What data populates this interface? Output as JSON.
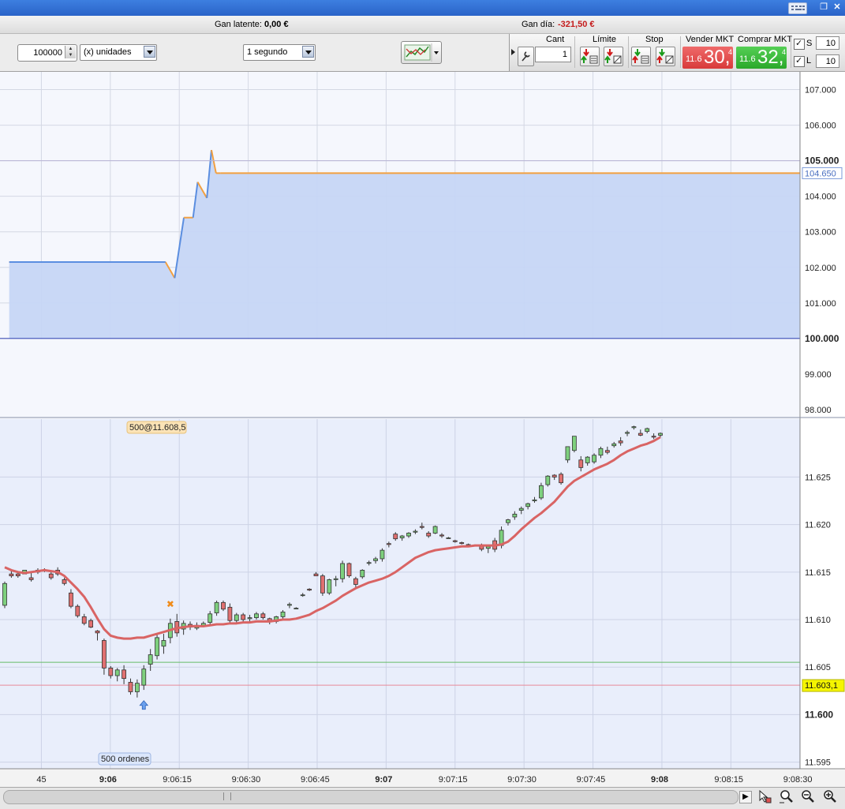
{
  "status": {
    "unrealized_label": "Gan latente:",
    "unrealized_value": "0,00 €",
    "daily_label": "Gan día:",
    "daily_value": "-321,50 €"
  },
  "toolbar": {
    "quantity": "100000",
    "unit_mode": "(x) unidades",
    "interval": "1 segundo"
  },
  "order_panel": {
    "cant_label": "Cant",
    "limit_label": "Límite",
    "stop_label": "Stop",
    "sell_label": "Vender MKT",
    "buy_label": "Comprar MKT",
    "qty_value": "1",
    "sell_prefix": "11.6",
    "sell_big": "30,",
    "sell_tiny": "4",
    "buy_prefix": "11.6",
    "buy_big": "32,",
    "buy_tiny": "4",
    "s_label": "S",
    "s_value": "10",
    "l_label": "L",
    "l_value": "10"
  },
  "colors": {
    "sell": "#e84d4d",
    "buy": "#33b533",
    "equity_line": "#5b8ee0",
    "equity_level_line": "#f2a040",
    "moving_average": "#d96464",
    "bull_candle": "#7ed07e",
    "bear_candle": "#e07070",
    "support_line": "#66bb66",
    "current_price_line": "#e88a9a",
    "current_price_tag": "#f5f500"
  },
  "icons": [
    "settings-wrench-icon",
    "limit-sell-icon",
    "limit-buy-icon",
    "stop-sell-icon",
    "stop-buy-icon",
    "chart-type-icon",
    "scroll-right-icon",
    "cursor-icon",
    "zoom-fit-icon",
    "zoom-out-icon",
    "zoom-in-icon",
    "keyboard-icon",
    "restore-window-icon",
    "close-window-icon"
  ],
  "chart_data": [
    {
      "type": "line",
      "title": "",
      "ylim": [
        97.8,
        107.5
      ],
      "y_ticks": [
        "107.000",
        "106.000",
        "105.000",
        "104.000",
        "103.000",
        "102.000",
        "101.000",
        "100.000",
        "99.000",
        "98.000"
      ],
      "bold_ticks": [
        "105.000",
        "100.000"
      ],
      "reference_level": 100.0,
      "current_value_tag": "104.650",
      "series": [
        {
          "x": [
            "9:05:38",
            "9:06:12",
            "9:06:14",
            "9:06:16",
            "9:06:18",
            "9:06:19",
            "9:06:21",
            "9:06:22",
            "9:06:23",
            "9:06:24",
            "9:08:30"
          ],
          "values": [
            102.15,
            102.15,
            101.7,
            103.4,
            103.4,
            104.4,
            103.95,
            105.3,
            104.65,
            104.65,
            104.65
          ]
        }
      ]
    },
    {
      "type": "candlestick",
      "title": "",
      "ylim": [
        11.5943,
        11.6311
      ],
      "y_ticks": [
        "11.625",
        "11.620",
        "11.615",
        "11.610",
        "11.605",
        "11.600",
        "11.595"
      ],
      "bold_ticks": [
        "11.600"
      ],
      "x_ticks": [
        "9:05:45",
        "9:06",
        "9:06:15",
        "9:06:30",
        "9:06:45",
        "9:07",
        "9:07:15",
        "9:07:30",
        "9:07:45",
        "9:08",
        "9:08:15",
        "9:08:30"
      ],
      "x_tick_labels": [
        "45",
        "9:06",
        "9:06:15",
        "9:06:30",
        "9:06:45",
        "9:07",
        "9:07:15",
        "9:07:30",
        "9:07:45",
        "9:08",
        "9:08:15",
        "9:08:30"
      ],
      "support_level": 11.6055,
      "current_price_level": 11.6031,
      "current_price_tag": "11.603,1",
      "entry_tag": "500@11.608,5",
      "orders_tag": "500 ordenes",
      "ohlc": [
        [
          11.6115,
          11.614,
          11.6112,
          11.6138
        ],
        [
          11.6148,
          11.6152,
          11.6144,
          11.6146
        ],
        [
          11.6148,
          11.615,
          11.6144,
          11.6146
        ],
        [
          11.6148,
          11.6152,
          11.6148,
          11.6152
        ],
        [
          11.6144,
          11.615,
          11.614,
          11.6142
        ],
        [
          11.6152,
          11.6154,
          11.6148,
          11.615
        ],
        [
          11.6152,
          11.6154,
          11.615,
          11.6151
        ],
        [
          11.6148,
          11.6152,
          11.6142,
          11.6144
        ],
        [
          11.6152,
          11.6155,
          11.6146,
          11.6148
        ],
        [
          11.6142,
          11.6144,
          11.6136,
          11.6138
        ],
        [
          11.6128,
          11.6132,
          11.6112,
          11.6114
        ],
        [
          11.6114,
          11.6116,
          11.6102,
          11.6104
        ],
        [
          11.6103,
          11.6106,
          11.6094,
          11.6096
        ],
        [
          11.6099,
          11.6101,
          11.6091,
          11.6092
        ],
        [
          11.6088,
          11.6089,
          11.6078,
          11.6086
        ],
        [
          11.6078,
          11.608,
          11.6042,
          11.6049
        ],
        [
          11.6049,
          11.6051,
          11.6038,
          11.6041
        ],
        [
          11.6041,
          11.6049,
          11.6035,
          11.6047
        ],
        [
          11.6047,
          11.6052,
          11.6032,
          11.6038
        ],
        [
          11.6034,
          11.6038,
          11.6021,
          11.6024
        ],
        [
          11.6024,
          11.6037,
          11.6018,
          11.6033
        ],
        [
          11.6031,
          11.6052,
          11.6026,
          11.6048
        ],
        [
          11.6053,
          11.6069,
          11.6046,
          11.6063
        ],
        [
          11.6062,
          11.6084,
          11.6058,
          11.6081
        ],
        [
          11.6072,
          11.6085,
          11.6064,
          11.6078
        ],
        [
          11.6081,
          11.6101,
          11.6075,
          11.6096
        ],
        [
          11.6098,
          11.6106,
          11.6082,
          11.6086
        ],
        [
          11.609,
          11.6099,
          11.6084,
          11.6096
        ],
        [
          11.6095,
          11.6098,
          11.6089,
          11.6092
        ],
        [
          11.6091,
          11.6097,
          11.6089,
          11.6094
        ],
        [
          11.6093,
          11.6098,
          11.6092,
          11.6096
        ],
        [
          11.6097,
          11.6109,
          11.6095,
          11.6106
        ],
        [
          11.6107,
          11.612,
          11.6104,
          11.6118
        ],
        [
          11.6118,
          11.612,
          11.6109,
          11.6111
        ],
        [
          11.6113,
          11.6117,
          11.6097,
          11.6099
        ],
        [
          11.6099,
          11.6107,
          11.6097,
          11.6105
        ],
        [
          11.6105,
          11.6107,
          11.6097,
          11.61
        ],
        [
          11.6101,
          11.6105,
          11.6097,
          11.6102
        ],
        [
          11.6102,
          11.6108,
          11.61,
          11.6106
        ],
        [
          11.6106,
          11.6108,
          11.61,
          11.6102
        ],
        [
          11.6101,
          11.6102,
          11.6095,
          11.6098
        ],
        [
          11.6098,
          11.6104,
          11.6096,
          11.6103
        ],
        [
          11.6103,
          11.611,
          11.6101,
          11.6108
        ],
        [
          11.6115,
          11.6118,
          11.6112,
          11.6116
        ],
        [
          11.6112,
          11.6113,
          11.6111,
          11.6112
        ],
        [
          11.6126,
          11.6128,
          11.6124,
          11.6126
        ],
        [
          11.6132,
          11.6133,
          11.613,
          11.6131
        ],
        [
          11.6148,
          11.615,
          11.6146,
          11.6146
        ],
        [
          11.6146,
          11.6148,
          11.6125,
          11.6128
        ],
        [
          11.6128,
          11.6143,
          11.6126,
          11.6142
        ],
        [
          11.6142,
          11.6146,
          11.6135,
          11.6143
        ],
        [
          11.6143,
          11.6162,
          11.6139,
          11.6159
        ],
        [
          11.6159,
          11.616,
          11.6144,
          11.6146
        ],
        [
          11.6143,
          11.6145,
          11.6132,
          11.6137
        ],
        [
          11.6145,
          11.6153,
          11.6143,
          11.6152
        ],
        [
          11.616,
          11.6162,
          11.6157,
          11.616
        ],
        [
          11.6162,
          11.6166,
          11.6159,
          11.6164
        ],
        [
          11.6164,
          11.6175,
          11.6161,
          11.6173
        ],
        [
          11.618,
          11.6182,
          11.6176,
          11.6179
        ],
        [
          11.619,
          11.6192,
          11.6183,
          11.6185
        ],
        [
          11.6186,
          11.6189,
          11.6183,
          11.6188
        ],
        [
          11.6188,
          11.6192,
          11.6186,
          11.6191
        ],
        [
          11.6192,
          11.6195,
          11.619,
          11.6193
        ],
        [
          11.6198,
          11.6202,
          11.6195,
          11.6197
        ],
        [
          11.6191,
          11.6193,
          11.6186,
          11.6188
        ],
        [
          11.6191,
          11.6199,
          11.619,
          11.6198
        ],
        [
          11.6189,
          11.6191,
          11.6186,
          11.6188
        ],
        [
          11.6186,
          11.6187,
          11.6185,
          11.6186
        ],
        [
          11.6183,
          11.6184,
          11.6181,
          11.6182
        ],
        [
          11.6181,
          11.6182,
          11.6179,
          11.618
        ],
        [
          11.6179,
          11.618,
          11.6177,
          11.6178
        ],
        [
          11.6178,
          11.6179,
          11.6177,
          11.6178
        ],
        [
          11.6178,
          11.618,
          11.6172,
          11.6174
        ],
        [
          11.6175,
          11.6178,
          11.617,
          11.6177
        ],
        [
          11.6183,
          11.6186,
          11.6171,
          11.6174
        ],
        [
          11.6178,
          11.6198,
          11.6175,
          11.6194
        ],
        [
          11.6202,
          11.6206,
          11.6199,
          11.6205
        ],
        [
          11.6208,
          11.6214,
          11.6205,
          11.6211
        ],
        [
          11.6215,
          11.6219,
          11.6211,
          11.6217
        ],
        [
          11.6219,
          11.6223,
          11.6216,
          11.6222
        ],
        [
          11.6225,
          11.6229,
          11.6223,
          11.6226
        ],
        [
          11.6228,
          11.6244,
          11.6226,
          11.6241
        ],
        [
          11.6242,
          11.6252,
          11.624,
          11.6251
        ],
        [
          11.6252,
          11.6253,
          11.6247,
          11.625
        ],
        [
          11.6253,
          11.6255,
          11.6242,
          11.6244
        ],
        [
          11.6268,
          11.6282,
          11.6265,
          11.6282
        ],
        [
          11.6278,
          11.6293,
          11.6276,
          11.6293
        ],
        [
          11.6268,
          11.6272,
          11.6256,
          11.626
        ],
        [
          11.6265,
          11.6272,
          11.6262,
          11.6271
        ],
        [
          11.6266,
          11.6275,
          11.6264,
          11.6273
        ],
        [
          11.6273,
          11.6282,
          11.627,
          11.628
        ],
        [
          11.6278,
          11.6282,
          11.6274,
          11.6276
        ],
        [
          11.6283,
          11.6287,
          11.6281,
          11.6285
        ],
        [
          11.6288,
          11.6292,
          11.6283,
          11.6286
        ],
        [
          11.6296,
          11.6299,
          11.6293,
          11.6297
        ],
        [
          11.6302,
          11.6304,
          11.63,
          11.6303
        ],
        [
          11.6296,
          11.63,
          11.6293,
          11.6294
        ],
        [
          11.6298,
          11.6302,
          11.6296,
          11.6301
        ],
        [
          11.6293,
          11.6296,
          11.629,
          11.6292
        ],
        [
          11.6294,
          11.6297,
          11.6292,
          11.6296
        ]
      ],
      "moving_average": [
        11.6155,
        11.6152,
        11.615,
        11.6149,
        11.615,
        11.6151,
        11.6152,
        11.6151,
        11.615,
        11.6146,
        11.6139,
        11.6132,
        11.6124,
        11.6113,
        11.6101,
        11.609,
        11.6083,
        11.6081,
        11.608,
        11.608,
        11.6081,
        11.6081,
        11.6083,
        11.6085,
        11.6087,
        11.6089,
        11.6091,
        11.6092,
        11.6093,
        11.6093,
        11.6093,
        11.6094,
        11.6095,
        11.6095,
        11.6096,
        11.6096,
        11.6097,
        11.6097,
        11.6098,
        11.6098,
        11.6098,
        11.6099,
        11.61,
        11.61,
        11.6101,
        11.6103,
        11.6105,
        11.6109,
        11.6112,
        11.6116,
        11.612,
        11.6125,
        11.6129,
        11.6133,
        11.6136,
        11.6139,
        11.6141,
        11.6143,
        11.6146,
        11.615,
        11.6155,
        11.616,
        11.6165,
        11.6168,
        11.6171,
        11.6173,
        11.6174,
        11.6175,
        11.6176,
        11.6177,
        11.6177,
        11.6178,
        11.6178,
        11.6178,
        11.6178,
        11.6179,
        11.6182,
        11.6188,
        11.6195,
        11.6201,
        11.6207,
        11.6212,
        11.6218,
        11.6224,
        11.6232,
        11.624,
        11.6246,
        11.625,
        11.6254,
        11.6258,
        11.6261,
        11.6264,
        11.6268,
        11.6273,
        11.6277,
        11.628,
        11.6283,
        11.6285,
        11.6288,
        11.6292
      ],
      "markers": [
        {
          "kind": "cross",
          "label": "exit",
          "x_index": 25,
          "y": 11.6117
        },
        {
          "kind": "up-arrow",
          "label": "entry",
          "x_index": 21,
          "y": 11.6018
        }
      ]
    }
  ]
}
